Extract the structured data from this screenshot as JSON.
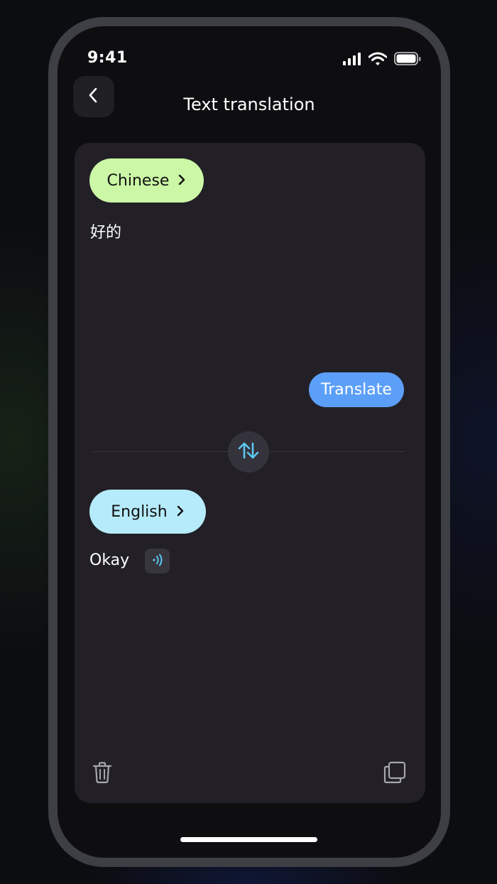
{
  "status_bar": {
    "time": "9:41",
    "icons": [
      "signal-icon",
      "wifi-icon",
      "battery-icon"
    ]
  },
  "header": {
    "title": "Text translation",
    "back_icon": "chevron-left-icon"
  },
  "source": {
    "language": "Chinese",
    "text": "好的",
    "pill_color": "#cbf7a6"
  },
  "translate_button": {
    "label": "Translate",
    "color": "#5c9ff8"
  },
  "swap_icon": "swap-vertical-icon",
  "target": {
    "language": "English",
    "text": "Okay",
    "pill_color": "#b6ebfb",
    "speak_icon": "speaker-icon"
  },
  "footer": {
    "delete_icon": "trash-icon",
    "copy_icon": "copy-icon"
  }
}
